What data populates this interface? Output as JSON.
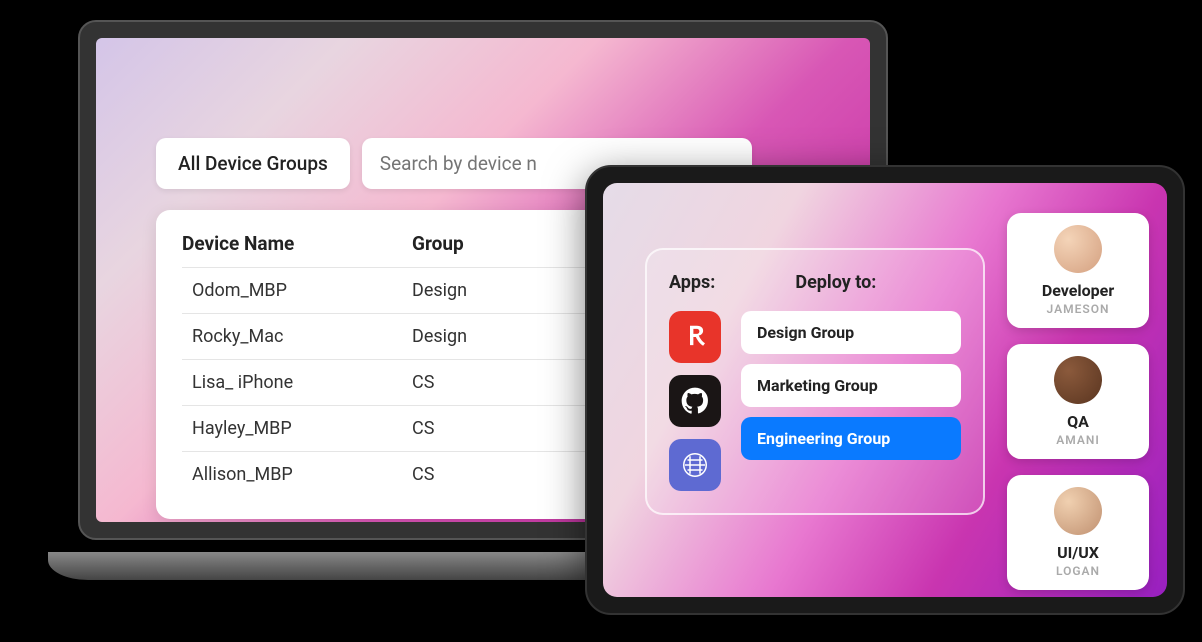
{
  "filter": {
    "label": "All Device Groups",
    "search_placeholder": "Search by device n"
  },
  "table": {
    "headers": {
      "name": "Device Name",
      "group": "Group"
    },
    "rows": [
      {
        "name": "Odom_MBP",
        "group": "Design"
      },
      {
        "name": "Rocky_Mac",
        "group": "Design"
      },
      {
        "name": "Lisa_ iPhone",
        "group": "CS"
      },
      {
        "name": "Hayley_MBP",
        "group": "CS"
      },
      {
        "name": "Allison_MBP",
        "group": "CS"
      }
    ]
  },
  "deploy": {
    "apps_label": "Apps:",
    "deploy_label": "Deploy to:",
    "apps": [
      "adobe-icon",
      "github-icon",
      "linear-icon"
    ],
    "groups": [
      {
        "label": "Design Group",
        "active": false
      },
      {
        "label": "Marketing Group",
        "active": false
      },
      {
        "label": "Engineering Group",
        "active": true
      }
    ]
  },
  "users": [
    {
      "role": "Developer",
      "name": "JAMESON"
    },
    {
      "role": "QA",
      "name": "AMANI"
    },
    {
      "role": "UI/UX",
      "name": "LOGAN"
    }
  ]
}
